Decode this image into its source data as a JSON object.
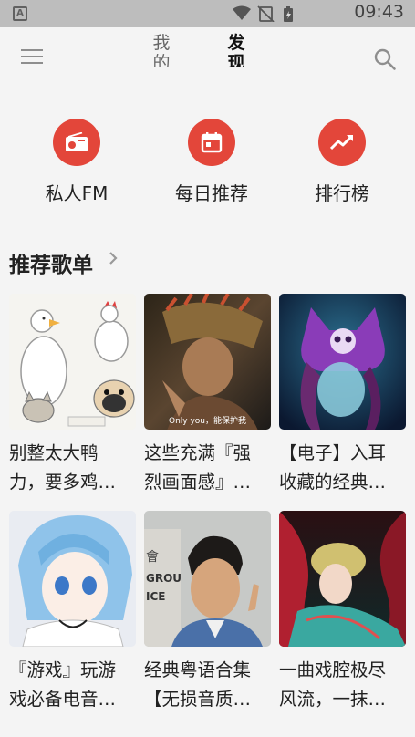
{
  "status_bar": {
    "time": "09:43",
    "app_badge": "A"
  },
  "header": {
    "tabs": [
      {
        "label": "我的"
      },
      {
        "label": "发现"
      }
    ]
  },
  "quick_entries": [
    {
      "label": "私人FM",
      "icon": "radio-icon"
    },
    {
      "label": "每日推荐",
      "icon": "calendar-icon"
    },
    {
      "label": "排行榜",
      "icon": "trending-icon"
    }
  ],
  "recommend": {
    "title": "推荐歌单",
    "playlists": [
      {
        "line1": "别整太大鸭",
        "line2": "力，要多鸡…"
      },
      {
        "line1": "这些充满『强",
        "line2": "烈画面感』…",
        "caption": "Only you，能保护我"
      },
      {
        "line1": "【电子】入耳",
        "line2": "收藏的经典…"
      },
      {
        "line1": "『游戏』玩游",
        "line2": "戏必备电音…"
      },
      {
        "line1": "经典粤语合集",
        "line2": "【无损音质…",
        "sign1": "會",
        "sign2": "GROU",
        "sign3": "ICE"
      },
      {
        "line1": "一曲戏腔极尽",
        "line2": "风流，一抹…"
      }
    ]
  },
  "colors": {
    "accent": "#e3463a",
    "status_bar": "#bdbdbd",
    "background": "#f4f4f4"
  }
}
